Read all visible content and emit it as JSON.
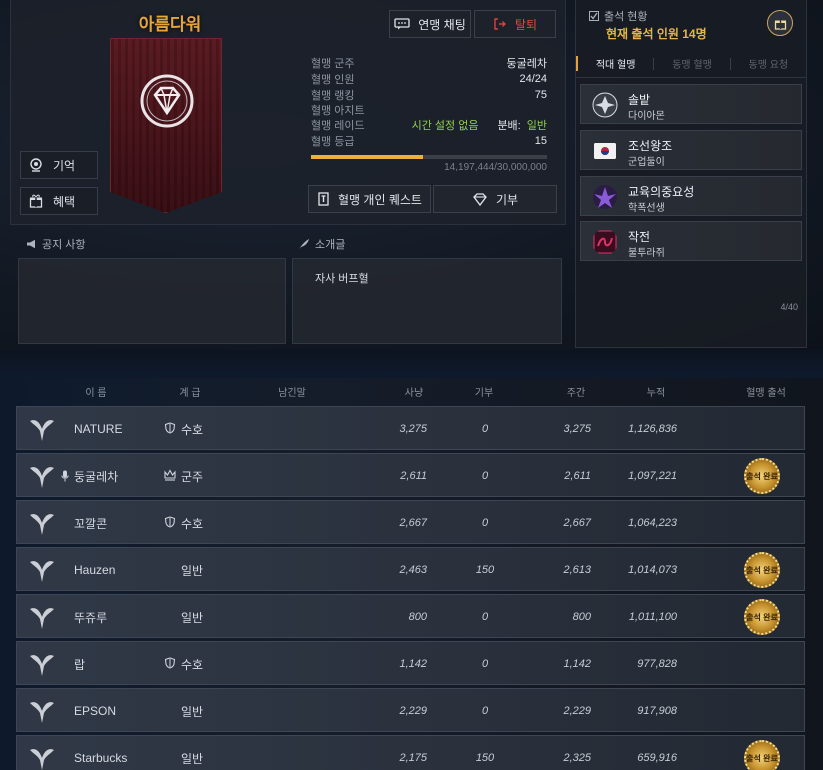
{
  "guild": {
    "name": "아름다워",
    "chat_label": "연맹 채팅",
    "leave_label": "탈퇴",
    "memory_label": "기억",
    "benefit_label": "혜택",
    "info": [
      {
        "label": "혈맹 군주",
        "value": "둥굴레차"
      },
      {
        "label": "혈맹 인원",
        "value": "24/24"
      },
      {
        "label": "혈맹 랭킹",
        "value": "75"
      },
      {
        "label": "혈맹 아지트",
        "value": ""
      },
      {
        "label": "혈맹 레이드",
        "value": "시간 설정 없음",
        "extra_label": "분배:",
        "extra_value": "일반"
      },
      {
        "label": "혈맹 등급",
        "value": "15"
      }
    ],
    "exp_text": "14,197,444/30,000,000",
    "exp_fraction": 0.473,
    "quest_label": "혈맹 개인 퀘스트",
    "donate_label": "기부"
  },
  "notice": {
    "title": "공지 사항",
    "content": ""
  },
  "intro": {
    "title": "소개글",
    "content": "자사 버프혈"
  },
  "attendance": {
    "title": "출석 현황",
    "count_text": "현재 출석 인원 14명"
  },
  "tabs": [
    "적대 혈맹",
    "동맹 혈맹",
    "동맹 요청"
  ],
  "enemies": [
    {
      "name": "솔밭",
      "sub": "다이아몬",
      "icon_color": "#d9dde3"
    },
    {
      "name": "조선왕조",
      "sub": "군업둘이",
      "icon_color": "#e8e8e8"
    },
    {
      "name": "교육의중요성",
      "sub": "학폭선생",
      "icon_color": "#8a5bd6"
    },
    {
      "name": "작전",
      "sub": "불투라쥐",
      "icon_color": "#e0306a"
    }
  ],
  "enemy_page": "4/40",
  "columns": {
    "name": "이 름",
    "rank": "계 급",
    "message": "남긴말",
    "hunt": "사냥",
    "donate": "기부",
    "weekly": "주간",
    "total": "누적",
    "attend": "혈맹 출석"
  },
  "stamp_text": "출석 완료",
  "members": [
    {
      "name": "NATURE",
      "rank": "수호",
      "rank_icon": "shield-icon",
      "hunt": "3,275",
      "donate": "0",
      "weekly": "3,275",
      "total": "1,126,836",
      "attended": false
    },
    {
      "name": "둥굴레차",
      "rank": "군주",
      "rank_icon": "crown-icon",
      "hunt": "2,611",
      "donate": "0",
      "weekly": "2,611",
      "total": "1,097,221",
      "attended": true,
      "mic": true
    },
    {
      "name": "꼬깔콘",
      "rank": "수호",
      "rank_icon": "shield-icon",
      "hunt": "2,667",
      "donate": "0",
      "weekly": "2,667",
      "total": "1,064,223",
      "attended": false
    },
    {
      "name": "Hauzen",
      "rank": "일반",
      "rank_icon": "",
      "hunt": "2,463",
      "donate": "150",
      "weekly": "2,613",
      "total": "1,014,073",
      "attended": true
    },
    {
      "name": "뚜쥬루",
      "rank": "일반",
      "rank_icon": "",
      "hunt": "800",
      "donate": "0",
      "weekly": "800",
      "total": "1,011,100",
      "attended": true
    },
    {
      "name": "랍",
      "rank": "수호",
      "rank_icon": "shield-icon",
      "hunt": "1,142",
      "donate": "0",
      "weekly": "1,142",
      "total": "977,828",
      "attended": false
    },
    {
      "name": "EPSON",
      "rank": "일반",
      "rank_icon": "",
      "hunt": "2,229",
      "donate": "0",
      "weekly": "2,229",
      "total": "917,908",
      "attended": false
    },
    {
      "name": "Starbucks",
      "rank": "일반",
      "rank_icon": "",
      "hunt": "2,175",
      "donate": "150",
      "weekly": "2,325",
      "total": "659,916",
      "attended": true
    }
  ]
}
